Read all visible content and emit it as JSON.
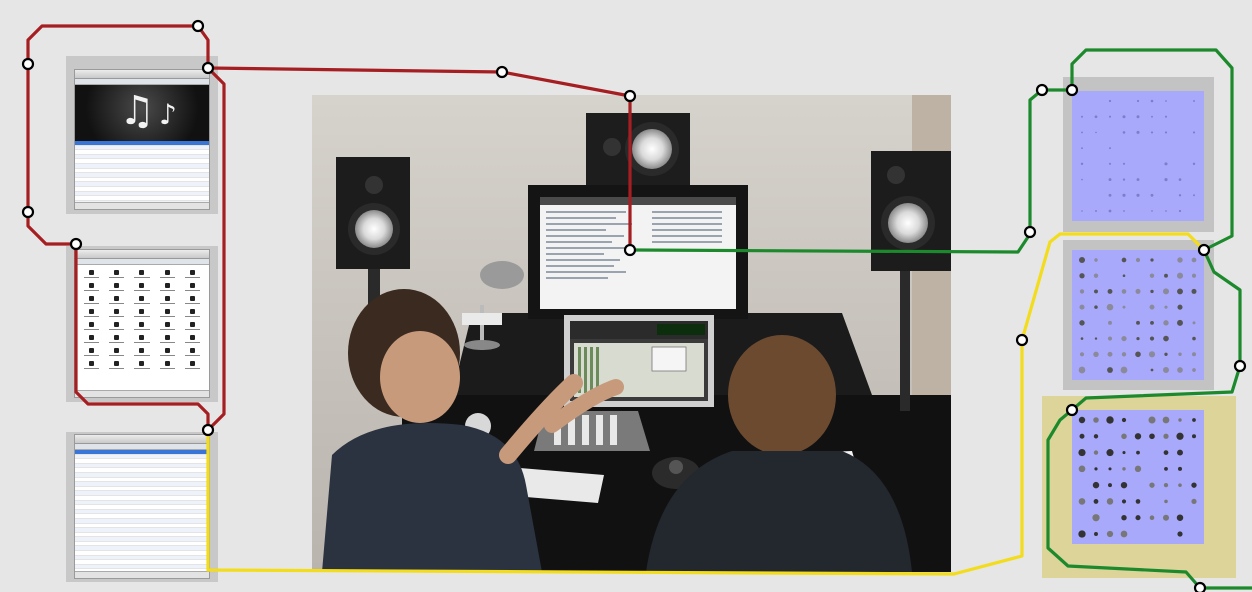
{
  "colors": {
    "red_line": "#a51e22",
    "green_line": "#1c8a2c",
    "yellow_line": "#f2dc1c",
    "thumbnail_screen": "#a9a9fb",
    "thumbnail_frame": "#c3c3c3",
    "thumbnail_frame_highlight": "#ddd49a",
    "background": "#e6e6e6"
  },
  "icons": {
    "music_note_large": "♫",
    "music_note_small": "♪"
  },
  "routes": [
    {
      "name": "red",
      "color": "red_line"
    },
    {
      "name": "green",
      "color": "green_line"
    },
    {
      "name": "yellow",
      "color": "yellow_line"
    }
  ],
  "dot_grids": [
    {
      "name": "sparse",
      "rows": 8,
      "cols": 9,
      "density": 0.6,
      "shade": "light"
    },
    {
      "name": "medium",
      "rows": 8,
      "cols": 9,
      "density": 0.75,
      "shade": "mixed"
    },
    {
      "name": "dense",
      "rows": 8,
      "cols": 9,
      "density": 0.8,
      "shade": "dark"
    }
  ]
}
